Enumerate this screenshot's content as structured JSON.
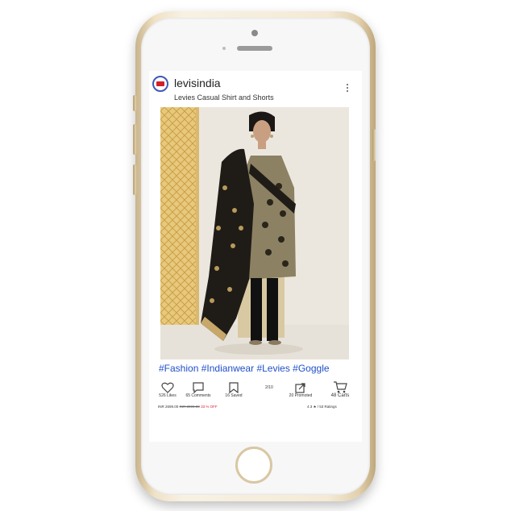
{
  "post": {
    "username": "levisindia",
    "subtitle": "Levies Casual Shirt and Shorts",
    "hashtags": [
      "#Fashion",
      "#Indianwear",
      "#Levies",
      "#Goggle"
    ],
    "actions": {
      "likes": "526 Likes",
      "comments": "65 Comments",
      "saved": "16 Saved",
      "page_indicator": "2/10",
      "promoted": "20 Promoted",
      "carts": "48 Carts"
    },
    "price": {
      "current": "INR 2699.00",
      "original": "INR 3999.00",
      "discount": "33 % OFF"
    },
    "rating": "4.3 ★ / 53 Ratings"
  },
  "icons": {
    "like": "heart-icon",
    "comment": "comment-icon",
    "save": "bookmark-icon",
    "promote": "share-icon",
    "cart": "cart-icon",
    "menu": "more-vertical-icon"
  },
  "colors": {
    "hashtag": "#1f4fc9",
    "discount": "#d21f2b",
    "phone_frame": "#efe2c6"
  }
}
